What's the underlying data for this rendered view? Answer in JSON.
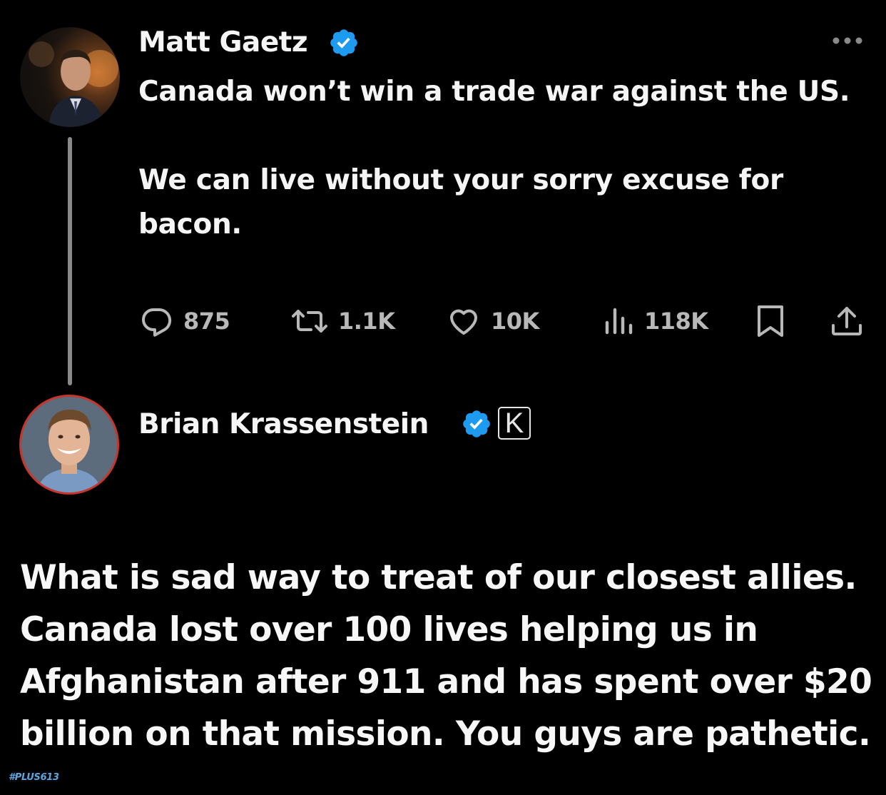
{
  "tweet": {
    "author_name": "Matt Gaetz",
    "lines": [
      "Canada won’t win a trade war against the US.",
      "We can live without your sorry excuse for bacon."
    ],
    "actions": {
      "replies": "875",
      "reposts": "1.1K",
      "likes": "10K",
      "views": "118K"
    },
    "icons": [
      "more-icon",
      "reply-icon",
      "repost-icon",
      "like-icon",
      "views-icon",
      "bookmark-icon",
      "share-icon"
    ]
  },
  "reply": {
    "author_name": "Brian Krassenstein",
    "badge_letter": "K",
    "text": "What is sad way to treat of our closest allies. Canada lost over 100 lives helping us in Afghanistan after 911 and has spent over $20 billion on that mission. You guys are pathetic."
  },
  "watermark": "#PLUS613",
  "colors": {
    "background": "#000000",
    "verified": "#1d9bf0",
    "text": "#f5f5f5",
    "muted": "#b8b8b8",
    "avatar_ring": "#c8362b"
  }
}
